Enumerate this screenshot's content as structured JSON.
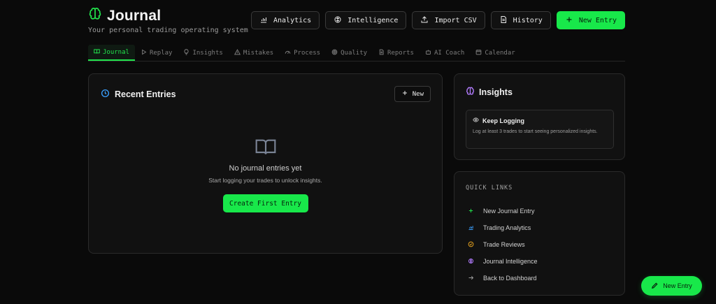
{
  "header": {
    "title": "Journal",
    "subtitle": "Your personal trading operating system",
    "brand_icon": "brain-icon",
    "actions": [
      {
        "label": "Analytics",
        "icon": "bar-chart-icon"
      },
      {
        "label": "Intelligence",
        "icon": "brain-icon"
      },
      {
        "label": "Import CSV",
        "icon": "upload-icon"
      },
      {
        "label": "History",
        "icon": "file-icon"
      },
      {
        "label": "New Entry",
        "icon": "plus-icon"
      }
    ]
  },
  "tabs": [
    {
      "label": "Journal",
      "icon": "book-icon",
      "active": true
    },
    {
      "label": "Replay",
      "icon": "play-icon"
    },
    {
      "label": "Insights",
      "icon": "lightbulb-icon"
    },
    {
      "label": "Mistakes",
      "icon": "warning-icon"
    },
    {
      "label": "Process",
      "icon": "gauge-icon"
    },
    {
      "label": "Quality",
      "icon": "target-icon"
    },
    {
      "label": "Reports",
      "icon": "file-icon"
    },
    {
      "label": "AI Coach",
      "icon": "bot-icon"
    },
    {
      "label": "Calendar",
      "icon": "calendar-icon"
    }
  ],
  "recent": {
    "title": "Recent Entries",
    "new_label": "New",
    "empty_title": "No journal entries yet",
    "empty_desc": "Start logging your trades to unlock insights.",
    "create_label": "Create First Entry"
  },
  "insights": {
    "title": "Insights",
    "item_title": "Keep Logging",
    "item_desc": "Log at least 3 trades to start seeing personalized insights."
  },
  "quick_links": {
    "title": "QUICK LINKS",
    "items": [
      {
        "label": "New Journal Entry",
        "icon": "plus-icon"
      },
      {
        "label": "Trading Analytics",
        "icon": "bar-chart-icon"
      },
      {
        "label": "Trade Reviews",
        "icon": "check-circle-icon"
      },
      {
        "label": "Journal Intelligence",
        "icon": "brain-icon"
      },
      {
        "label": "Back to Dashboard",
        "icon": "arrow-right-icon"
      }
    ]
  },
  "fab": {
    "label": "New Entry",
    "icon": "pen-icon"
  },
  "colors": {
    "accent": "#18e84a",
    "background": "#0a0a0a",
    "card": "#111111",
    "blue_icon": "#3aa0ff",
    "purple_icon": "#b27cff",
    "amber_icon": "#e5a21f"
  }
}
